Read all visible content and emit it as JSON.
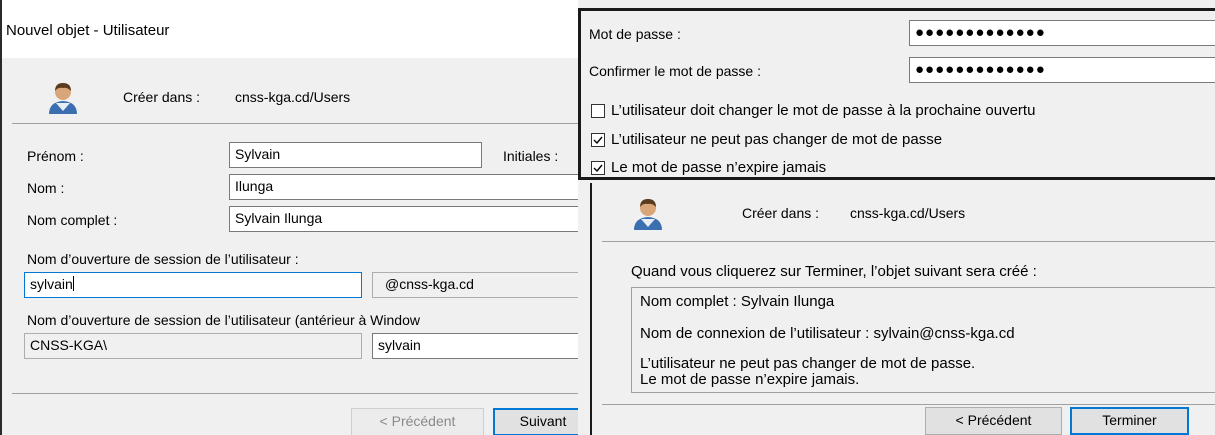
{
  "left_dialog": {
    "title": "Nouvel objet - Utilisateur",
    "create_in_label": "Créer dans :",
    "create_in_value": "cnss-kga.cd/Users",
    "first_name_label": "Prénom :",
    "first_name_value": "Sylvain",
    "initials_label": "Initiales :",
    "last_name_label": "Nom :",
    "last_name_value": "Ilunga",
    "full_name_label": "Nom complet :",
    "full_name_value": "Sylvain Ilunga",
    "logon_label": "Nom d’ouverture de session de l’utilisateur :",
    "logon_value": "sylvain",
    "logon_domain": "@cnss-kga.cd",
    "logon_pre2000_label": "Nom d’ouverture de session de l’utilisateur (antérieur à Window",
    "logon_pre2000_domain": "CNSS-KGA\\",
    "logon_pre2000_value": "sylvain",
    "prev_button": "< Précédent",
    "next_button": "Suivant"
  },
  "password_panel": {
    "password_label": "Mot de passe :",
    "password_value": "●●●●●●●●●●●●●",
    "confirm_label": "Confirmer le mot de passe :",
    "confirm_value": "●●●●●●●●●●●●●",
    "options": [
      {
        "label": "L’utilisateur doit changer le mot de passe à la prochaine ouvertu",
        "checked": false
      },
      {
        "label": "L’utilisateur ne peut pas changer de mot de passe",
        "checked": true
      },
      {
        "label": "Le mot de passe n’expire jamais",
        "checked": true
      }
    ]
  },
  "summary_panel": {
    "create_in_label": "Créer dans :",
    "create_in_value": "cnss-kga.cd/Users",
    "intro": "Quand vous cliquerez sur Terminer, l’objet suivant sera créé :",
    "summary_full_name": "Nom complet : Sylvain Ilunga",
    "summary_logon": "Nom de connexion de l’utilisateur : sylvain@cnss-kga.cd",
    "summary_line1": "L’utilisateur ne peut pas changer de mot de passe.",
    "summary_line2": "Le mot de passe n’expire jamais.",
    "prev_button": "< Précédent",
    "finish_button": "Terminer"
  },
  "colors": {
    "accent": "#0078d7",
    "window_bg": "#f0f0f0",
    "input_border": "#7a7a7a"
  }
}
